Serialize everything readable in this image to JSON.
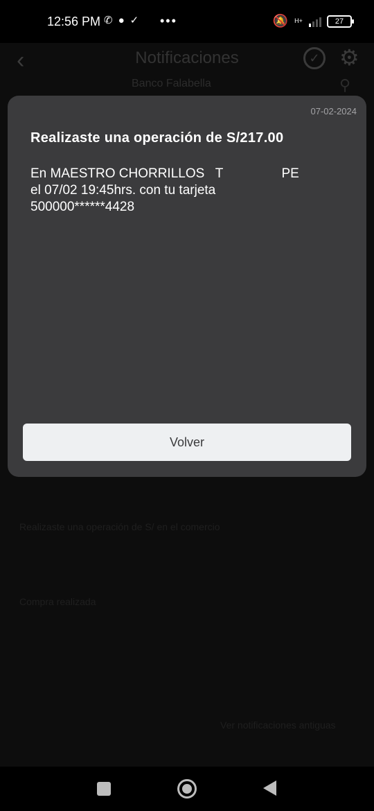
{
  "status_bar": {
    "time": "12:56 PM",
    "left_icons": [
      "whatsapp-icon",
      "chat-bubble-icon",
      "download-check-icon"
    ],
    "overflow": "•••",
    "network_type": "H+",
    "battery": "27"
  },
  "app": {
    "title": "Notificaciones",
    "bank_label": "Banco Falabella",
    "background_rows": [
      "Realizaste una operación de S/ en el comercio",
      "Compra realizada",
      "Ver notificaciones antiguas"
    ]
  },
  "dialog": {
    "date": "07-02-2024",
    "title": "Realizaste una operación de S/217.00",
    "body_lines": [
      "En MAESTRO CHORRILLOS   T                PE",
      "el 07/02 19:45hrs. con tu tarjeta",
      "500000******4428"
    ],
    "button_label": "Volver"
  },
  "nav_bar": {
    "buttons": [
      "recents",
      "home",
      "back"
    ]
  }
}
